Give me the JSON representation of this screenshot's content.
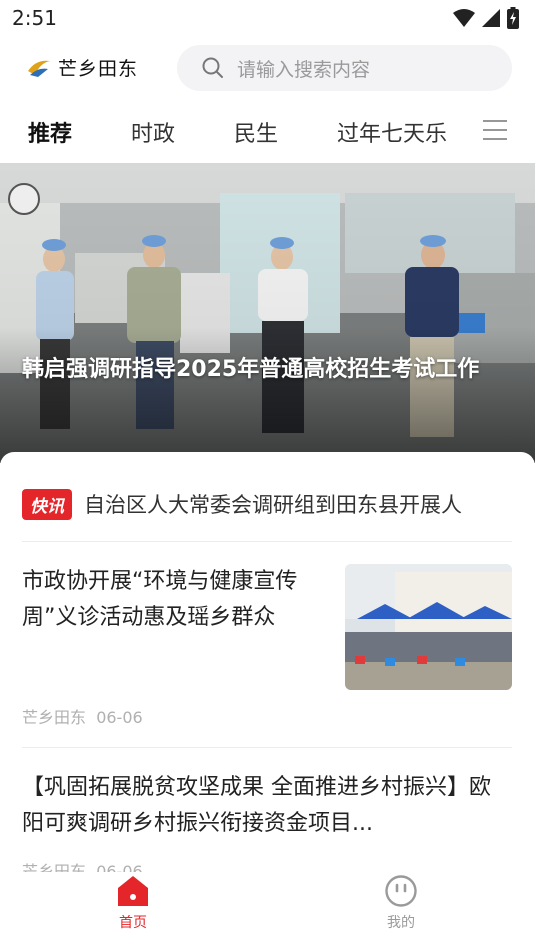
{
  "status": {
    "time": "2:51"
  },
  "header": {
    "logo_text": "芒乡田东",
    "search_placeholder": "请输入搜索内容"
  },
  "tabs": [
    {
      "label": "推荐",
      "active": true
    },
    {
      "label": "时政",
      "active": false
    },
    {
      "label": "民生",
      "active": false
    },
    {
      "label": "过年七天乐",
      "active": false
    }
  ],
  "hero": {
    "title": "韩启强调研指导2025年普通高校招生考试工作"
  },
  "flash": {
    "badge": "快讯",
    "text": "自治区人大常委会调研组到田东县开展人"
  },
  "news": [
    {
      "title": "市政协开展“环境与健康宣传周”义诊活动惠及瑶乡群众",
      "source": "芒乡田东",
      "date": "06-06"
    },
    {
      "title": "【巩固拓展脱贫攻坚成果 全面推进乡村振兴】欧阳可爽调研乡村振兴衔接资金项目...",
      "source": "芒乡田东",
      "date": "06-06"
    }
  ],
  "bottom_nav": [
    {
      "label": "首页",
      "active": true
    },
    {
      "label": "我的",
      "active": false
    }
  ],
  "colors": {
    "accent": "#e4262b",
    "inactive": "#9a9a9a"
  }
}
